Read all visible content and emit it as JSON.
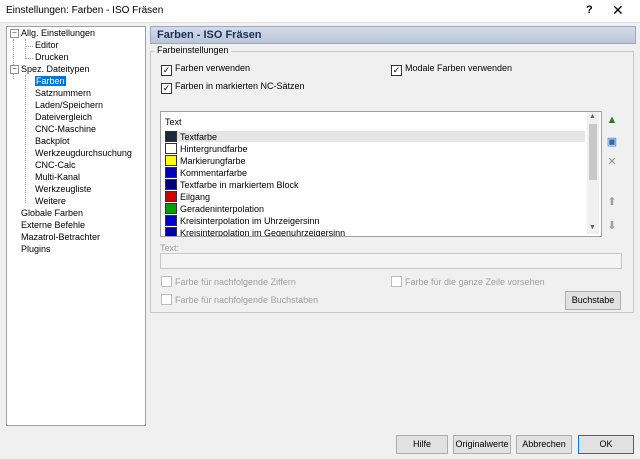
{
  "window": {
    "title": "Einstellungen: Farben - ISO Fräsen",
    "help": "?",
    "close": "✕"
  },
  "tree": [
    {
      "label": "Allg. Einstellungen"
    },
    {
      "label": "Editor"
    },
    {
      "label": "Drucken"
    },
    {
      "label": "Spez. Dateitypen"
    },
    {
      "label": "Farben"
    },
    {
      "label": "Satznummern"
    },
    {
      "label": "Laden/Speichern"
    },
    {
      "label": "Dateivergleich"
    },
    {
      "label": "CNC-Maschine"
    },
    {
      "label": "Backplot"
    },
    {
      "label": "Werkzeugdurchsuchung"
    },
    {
      "label": "CNC-Calc"
    },
    {
      "label": "Multi-Kanal"
    },
    {
      "label": "Werkzeugliste"
    },
    {
      "label": "Weitere"
    },
    {
      "label": "Globale Farben"
    },
    {
      "label": "Externe Befehle"
    },
    {
      "label": "Mazatrol-Betrachter"
    },
    {
      "label": "Plugins"
    }
  ],
  "header": {
    "title": "Farben - ISO Fräsen"
  },
  "group": {
    "title": "Farbeinstellungen"
  },
  "checks": {
    "farben_verwenden": {
      "label": "Farben verwenden",
      "checked": true
    },
    "modale_farben": {
      "label": "Modale Farben verwenden",
      "checked": true
    },
    "markierte_nc": {
      "label": "Farben in markierten NC-Sätzen",
      "checked": true
    }
  },
  "list": {
    "header": "Text",
    "items": [
      {
        "label": "Textfarbe",
        "color": "#1a2a3a"
      },
      {
        "label": "Hintergrundfarbe",
        "color": "#ffffff"
      },
      {
        "label": "Markierungfarbe",
        "color": "#ffff00"
      },
      {
        "label": "Kommentarfarbe",
        "color": "#0000c0"
      },
      {
        "label": "Textfarbe in markiertem Block",
        "color": "#000080"
      },
      {
        "label": "Eilgang",
        "color": "#cc0000"
      },
      {
        "label": "Geradeninterpolation",
        "color": "#00a000"
      },
      {
        "label": "Kreisinterpolation im Uhrzeigersinn",
        "color": "#0000cc"
      },
      {
        "label": "Kreisinterpolation im Gegenuhrzeigersinn",
        "color": "#0000aa"
      }
    ]
  },
  "text_field": {
    "label": "Text:",
    "value": ""
  },
  "disabled_checks": {
    "zifferen": "Farbe für nachfolgende Ziffern",
    "zeile": "Farbe für die ganze Zeile vorsehen",
    "buchstaben": "Farbe für nachfolgende Buchstaben"
  },
  "buttons": {
    "buchstabe": "Buchstabe",
    "hilfe": "Hilfe",
    "originalwerte": "Originalwerte",
    "abbrechen": "Abbrechen",
    "ok": "OK"
  },
  "icons": {
    "add": "add-icon",
    "copy": "copy-icon",
    "delete": "delete-icon",
    "up": "arrow-up-icon",
    "down": "arrow-down-icon"
  }
}
